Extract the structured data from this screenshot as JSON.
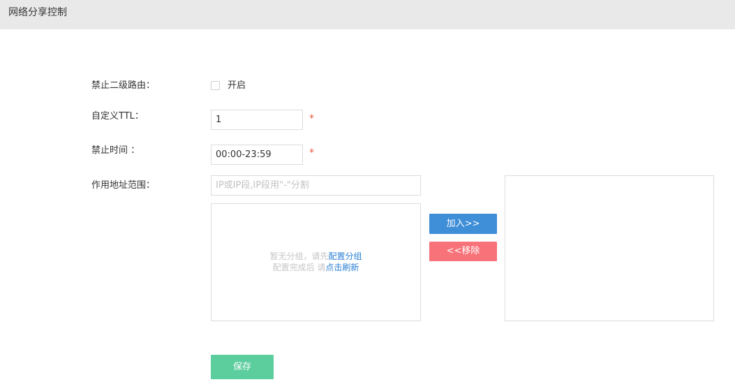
{
  "header": {
    "title": "网络分享控制"
  },
  "form": {
    "block_secondary_router": {
      "label": "禁止二级路由：",
      "checkbox_label": "开启",
      "checked": false
    },
    "custom_ttl": {
      "label": "自定义TTL：",
      "value": "1",
      "required_mark": "*"
    },
    "block_time": {
      "label": "禁止时间 ：",
      "value": "00:00-23:59",
      "required_mark": "*"
    },
    "address_range": {
      "label": "作用地址范围：",
      "placeholder": "IP或IP段,IP段用\"-\"分割",
      "empty_text_1": "暂无分组，请先",
      "config_group_link": "配置分组",
      "empty_text_2": "配置完成后 请",
      "refresh_link": "点击刷新"
    }
  },
  "buttons": {
    "add_label": "加入>>",
    "remove_label": "<<移除",
    "save_label": "保存"
  },
  "colors": {
    "header_bg": "#e9e9e9",
    "add_button": "#3f8ed8",
    "remove_button": "#f87279",
    "save_button": "#5ccd9d",
    "required": "#e8553c",
    "link": "#2a7fd4"
  }
}
